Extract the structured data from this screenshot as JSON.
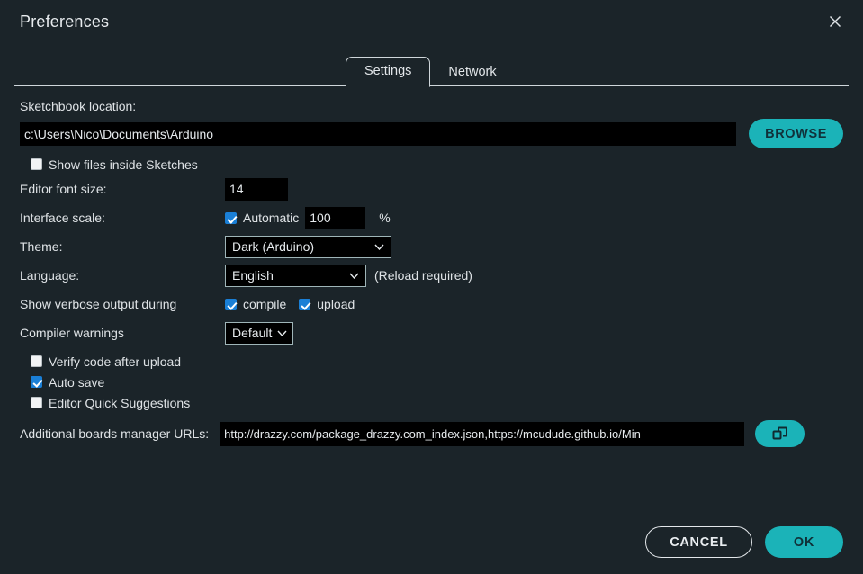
{
  "dialog": {
    "title": "Preferences",
    "close_icon": "close-icon"
  },
  "tabs": [
    {
      "label": "Settings",
      "active": true
    },
    {
      "label": "Network",
      "active": false
    }
  ],
  "settings": {
    "sketchbook": {
      "label": "Sketchbook location:",
      "value": "c:\\Users\\Nico\\Documents\\Arduino",
      "browse_label": "BROWSE"
    },
    "show_files_inside_sketches": {
      "label": "Show files inside Sketches",
      "checked": false
    },
    "editor_font_size": {
      "label": "Editor font size:",
      "value": "14"
    },
    "interface_scale": {
      "label": "Interface scale:",
      "automatic_label": "Automatic",
      "automatic_checked": true,
      "value": "100",
      "unit": "%"
    },
    "theme": {
      "label": "Theme:",
      "value": "Dark (Arduino)"
    },
    "language": {
      "label": "Language:",
      "value": "English",
      "note": "(Reload required)"
    },
    "verbose_output": {
      "label": "Show verbose output during",
      "compile_label": "compile",
      "compile_checked": true,
      "upload_label": "upload",
      "upload_checked": true
    },
    "compiler_warnings": {
      "label": "Compiler warnings",
      "value": "Default"
    },
    "verify_code_after_upload": {
      "label": "Verify code after upload",
      "checked": false
    },
    "auto_save": {
      "label": "Auto save",
      "checked": true
    },
    "editor_quick_suggestions": {
      "label": "Editor Quick Suggestions",
      "checked": false
    },
    "boards_manager_urls": {
      "label": "Additional boards manager URLs:",
      "value": "http://drazzy.com/package_drazzy.com_index.json,https://mcudude.github.io/Min",
      "edit_icon": "copy-windows-icon"
    }
  },
  "footer": {
    "cancel_label": "CANCEL",
    "ok_label": "OK"
  },
  "colors": {
    "background": "#1b2429",
    "accent_teal": "#1bb3b8",
    "checkbox_blue": "#1a7fd6",
    "field_background": "#000000",
    "text": "#dfe3e6",
    "border_light": "#cfd6da"
  }
}
